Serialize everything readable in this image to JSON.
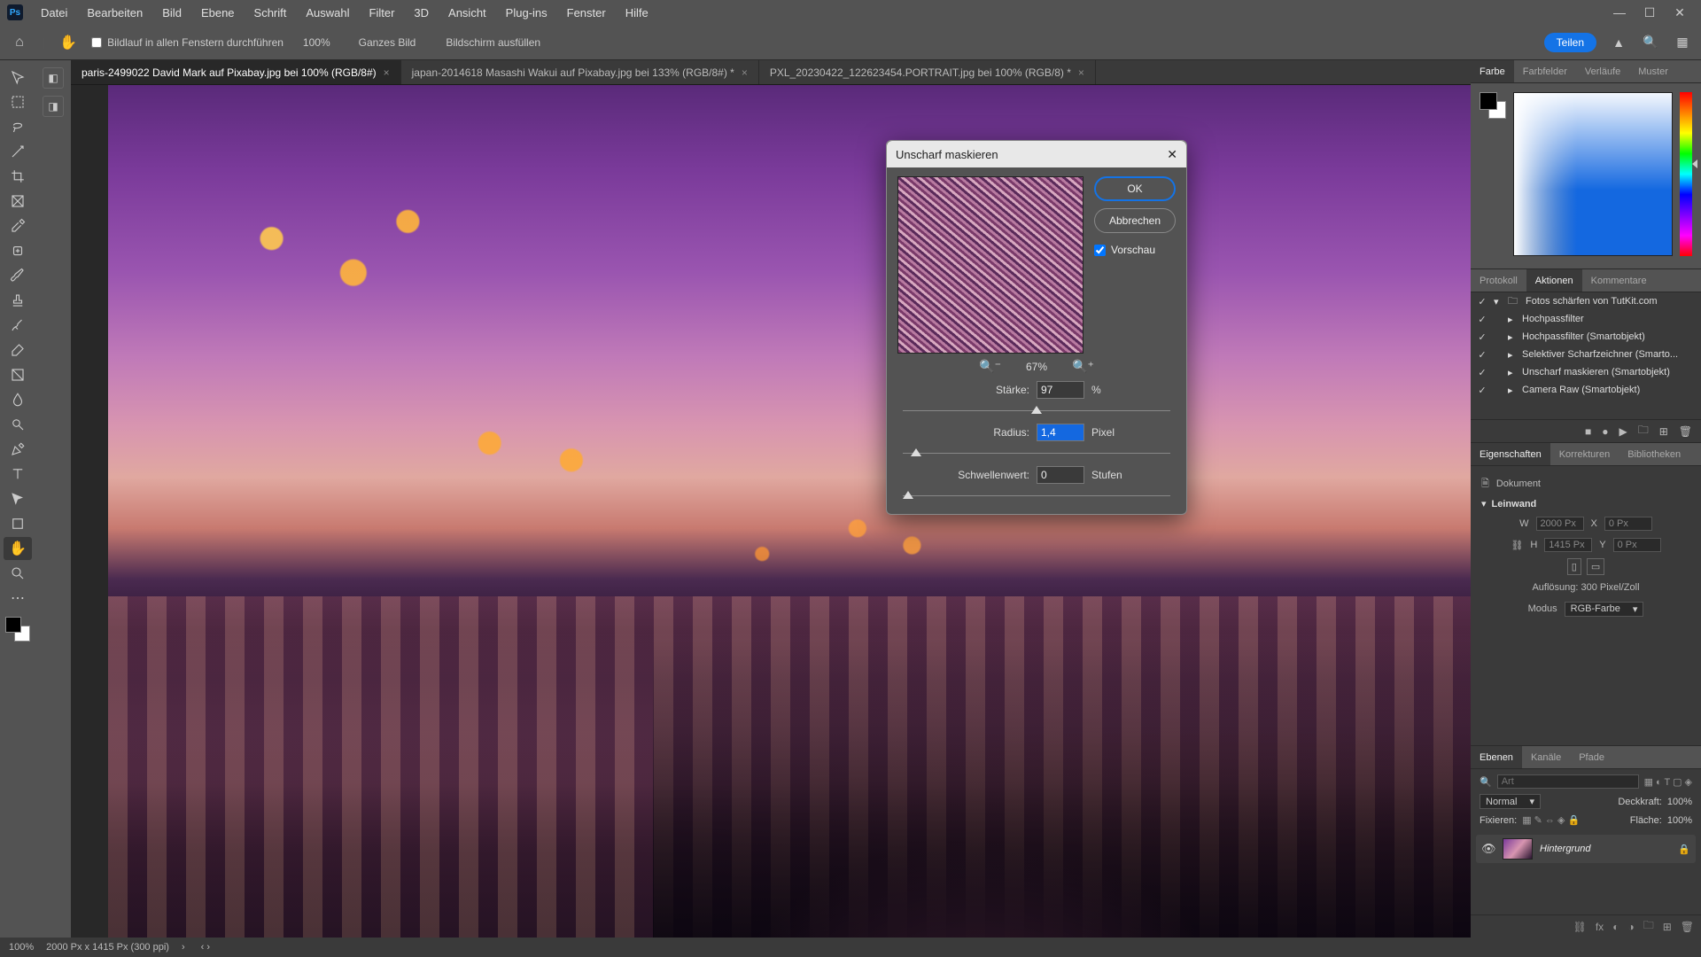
{
  "menu": [
    "Datei",
    "Bearbeiten",
    "Bild",
    "Ebene",
    "Schrift",
    "Auswahl",
    "Filter",
    "3D",
    "Ansicht",
    "Plug-ins",
    "Fenster",
    "Hilfe"
  ],
  "optionbar": {
    "scroll_all_label": "Bildlauf in allen Fenstern durchführen",
    "zoom": "100%",
    "fit_label": "Ganzes Bild",
    "fill_label": "Bildschirm ausfüllen",
    "share_label": "Teilen"
  },
  "tabs": [
    "paris-2499022  David Mark auf Pixabay.jpg bei 100% (RGB/8#)",
    "japan-2014618 Masashi Wakui auf Pixabay.jpg bei 133% (RGB/8#) *",
    "PXL_20230422_122623454.PORTRAIT.jpg bei 100% (RGB/8) *"
  ],
  "dialog": {
    "title": "Unscharf maskieren",
    "ok": "OK",
    "cancel": "Abbrechen",
    "preview_label": "Vorschau",
    "preview_checked": true,
    "zoom": "67%",
    "amount_label": "Stärke:",
    "amount_value": "97",
    "amount_unit": "%",
    "radius_label": "Radius:",
    "radius_value": "1,4",
    "radius_unit": "Pixel",
    "threshold_label": "Schwellenwert:",
    "threshold_value": "0",
    "threshold_unit": "Stufen"
  },
  "color_tabs": [
    "Farbe",
    "Farbfelder",
    "Verläufe",
    "Muster"
  ],
  "history_tabs": [
    "Protokoll",
    "Aktionen",
    "Kommentare"
  ],
  "actions": {
    "folder": "Fotos schärfen von TutKit.com",
    "items": [
      "Hochpassfilter",
      "Hochpassfilter (Smartobjekt)",
      "Selektiver Scharfzeichner (Smarto...",
      "Unscharf maskieren (Smartobjekt)",
      "Camera Raw (Smartobjekt)"
    ]
  },
  "prop_tabs": [
    "Eigenschaften",
    "Korrekturen",
    "Bibliotheken"
  ],
  "properties": {
    "doc_label": "Dokument",
    "canvas_label": "Leinwand",
    "w_label": "W",
    "w_val": "2000 Px",
    "x_label": "X",
    "x_val": "0 Px",
    "h_label": "H",
    "h_val": "1415 Px",
    "y_label": "Y",
    "y_val": "0 Px",
    "res_label": "Auflösung: 300 Pixel/Zoll",
    "mode_label": "Modus",
    "mode_value": "RGB-Farbe"
  },
  "layer_tabs": [
    "Ebenen",
    "Kanäle",
    "Pfade"
  ],
  "layers": {
    "search_placeholder": "Art",
    "blend": "Normal",
    "opacity_label": "Deckkraft:",
    "opacity": "100%",
    "lock_label": "Fixieren:",
    "fill_label": "Fläche:",
    "fill": "100%",
    "layer_name": "Hintergrund"
  },
  "status": {
    "zoom": "100%",
    "dims": "2000 Px x 1415 Px (300 ppi)"
  }
}
